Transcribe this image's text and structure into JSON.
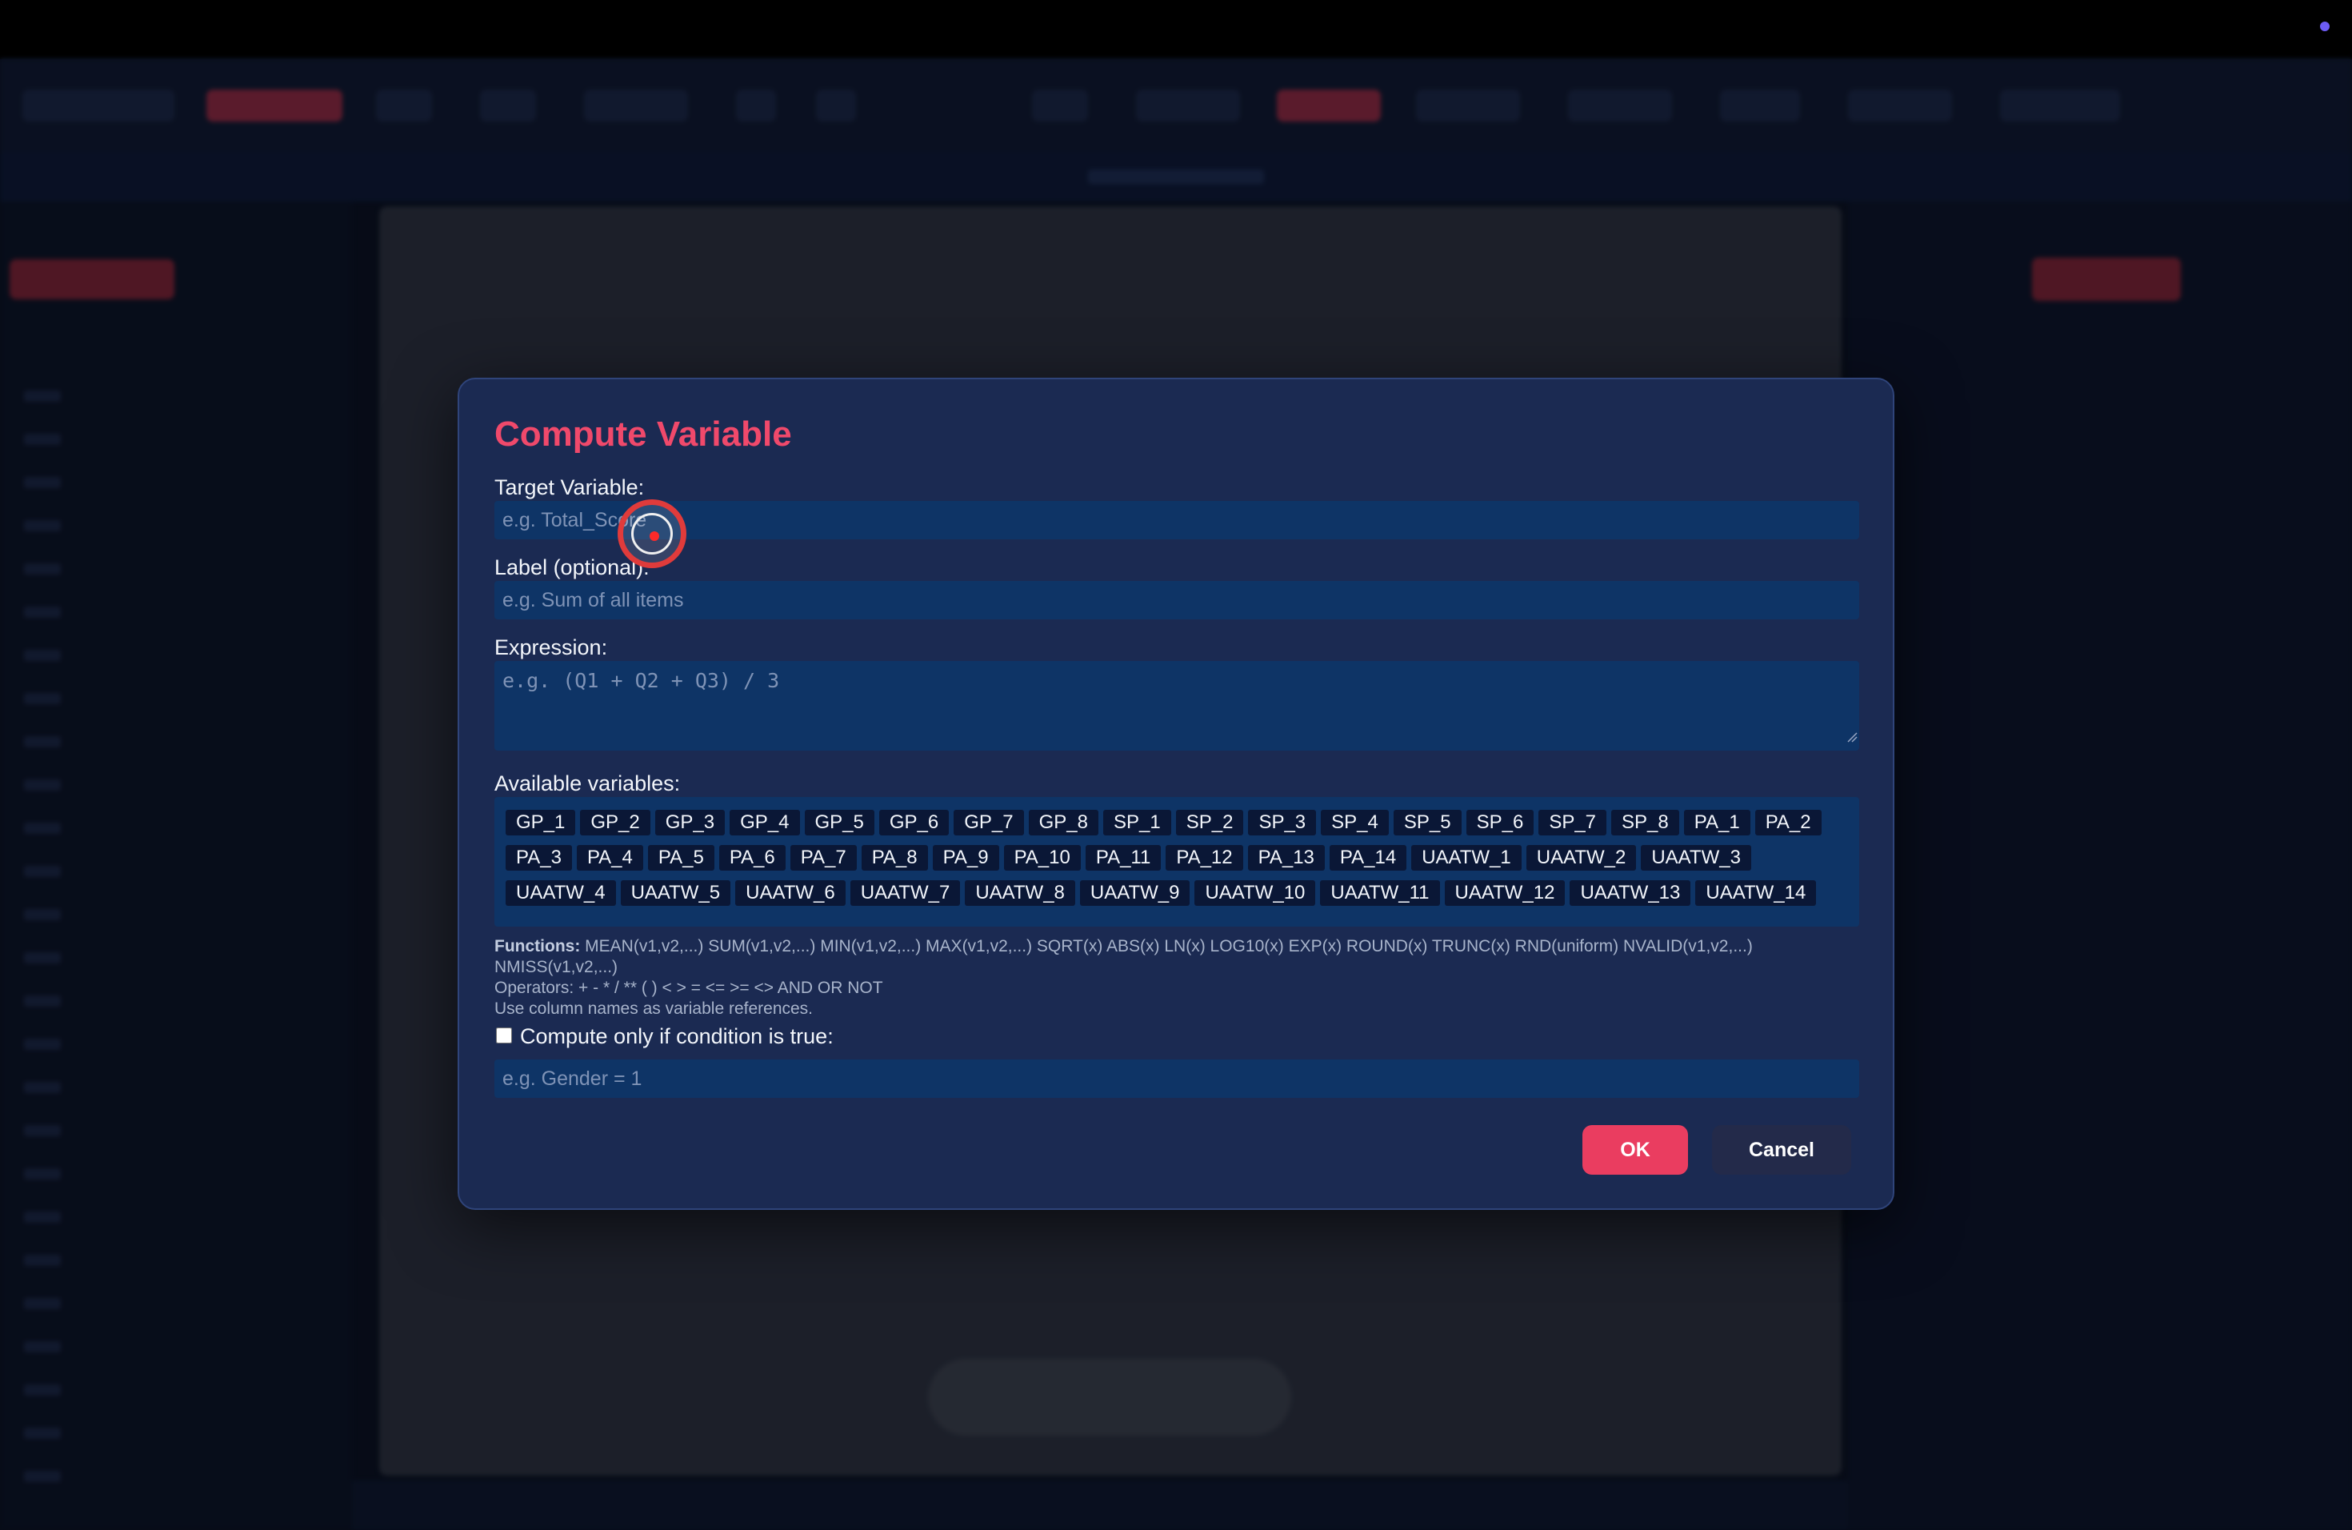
{
  "dialog": {
    "title": "Compute Variable",
    "target_label": "Target Variable:",
    "target_placeholder": "e.g. Total_Score",
    "label_label": "Label (optional):",
    "label_placeholder": "e.g. Sum of all items",
    "expression_label": "Expression:",
    "expression_placeholder": "e.g. (Q1 + Q2 + Q3) / 3",
    "available_label": "Available variables:",
    "variables": [
      "GP_1",
      "GP_2",
      "GP_3",
      "GP_4",
      "GP_5",
      "GP_6",
      "GP_7",
      "GP_8",
      "SP_1",
      "SP_2",
      "SP_3",
      "SP_4",
      "SP_5",
      "SP_6",
      "SP_7",
      "SP_8",
      "PA_1",
      "PA_2",
      "PA_3",
      "PA_4",
      "PA_5",
      "PA_6",
      "PA_7",
      "PA_8",
      "PA_9",
      "PA_10",
      "PA_11",
      "PA_12",
      "PA_13",
      "PA_14",
      "UAATW_1",
      "UAATW_2",
      "UAATW_3",
      "UAATW_4",
      "UAATW_5",
      "UAATW_6",
      "UAATW_7",
      "UAATW_8",
      "UAATW_9",
      "UAATW_10",
      "UAATW_11",
      "UAATW_12",
      "UAATW_13",
      "UAATW_14"
    ],
    "help": {
      "functions_label": "Functions:",
      "functions_text": "MEAN(v1,v2,...) SUM(v1,v2,...) MIN(v1,v2,...) MAX(v1,v2,...) SQRT(x) ABS(x) LN(x) LOG10(x) EXP(x) ROUND(x) TRUNC(x) RND(uniform) NVALID(v1,v2,...) NMISS(v1,v2,...)",
      "operators": "Operators: + - * / ** ( ) < > = <= >= <> AND OR NOT",
      "usage": "Use column names as variable references."
    },
    "condition_label": "Compute only if condition is true:",
    "condition_checked": false,
    "condition_placeholder": "e.g. Gender = 1",
    "ok_label": "OK",
    "cancel_label": "Cancel"
  },
  "colors": {
    "title": "#f0496b",
    "ok_button": "#ea3d60",
    "dialog_bg": "#1b2a52",
    "field_bg": "#0e3466"
  }
}
